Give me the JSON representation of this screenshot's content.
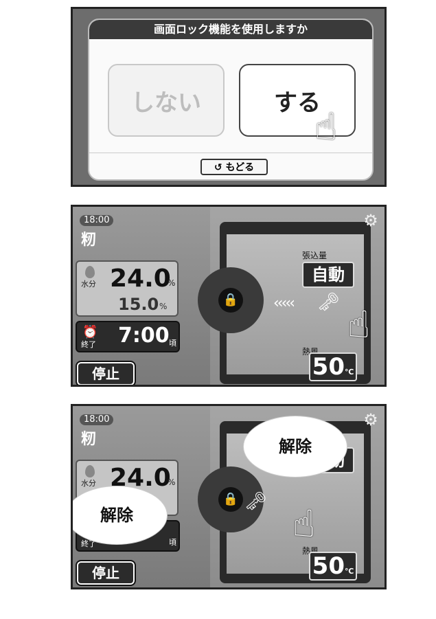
{
  "panel1": {
    "title": "画面ロック機能を使用しますか",
    "option_no": "しない",
    "option_yes": "する",
    "back_label": "もどる",
    "back_icon": "undo-icon"
  },
  "panel2": {
    "time": "18:00",
    "crop": "籾",
    "moisture_label": "水分",
    "moisture_current": "24.0",
    "moisture_target": "15.0",
    "moisture_unit": "%",
    "end_label": "終了",
    "end_time": "7:00",
    "end_unit": "頃",
    "stop_label": "停止",
    "amount_label": "張込量",
    "amount_value": "自動",
    "heat_label": "熱風",
    "heat_value": "50",
    "heat_unit": "℃",
    "lock_icon": "lock-icon",
    "key_icon": "key-icon"
  },
  "panel3": {
    "time": "18:00",
    "crop": "籾",
    "moisture_label": "水分",
    "moisture_current": "24.0",
    "moisture_unit": "%",
    "end_label": "終了",
    "end_unit": "頃",
    "stop_label": "停止",
    "amount_value": "自動",
    "heat_label": "熱風",
    "heat_value": "50",
    "heat_unit": "℃",
    "bubble_top": "解除",
    "bubble_left": "解除"
  },
  "colors": {
    "dark_panel": "#2b2b2b",
    "dialog_title_bg": "#3a3a3a",
    "option_disabled_text": "#bdbdbd"
  }
}
